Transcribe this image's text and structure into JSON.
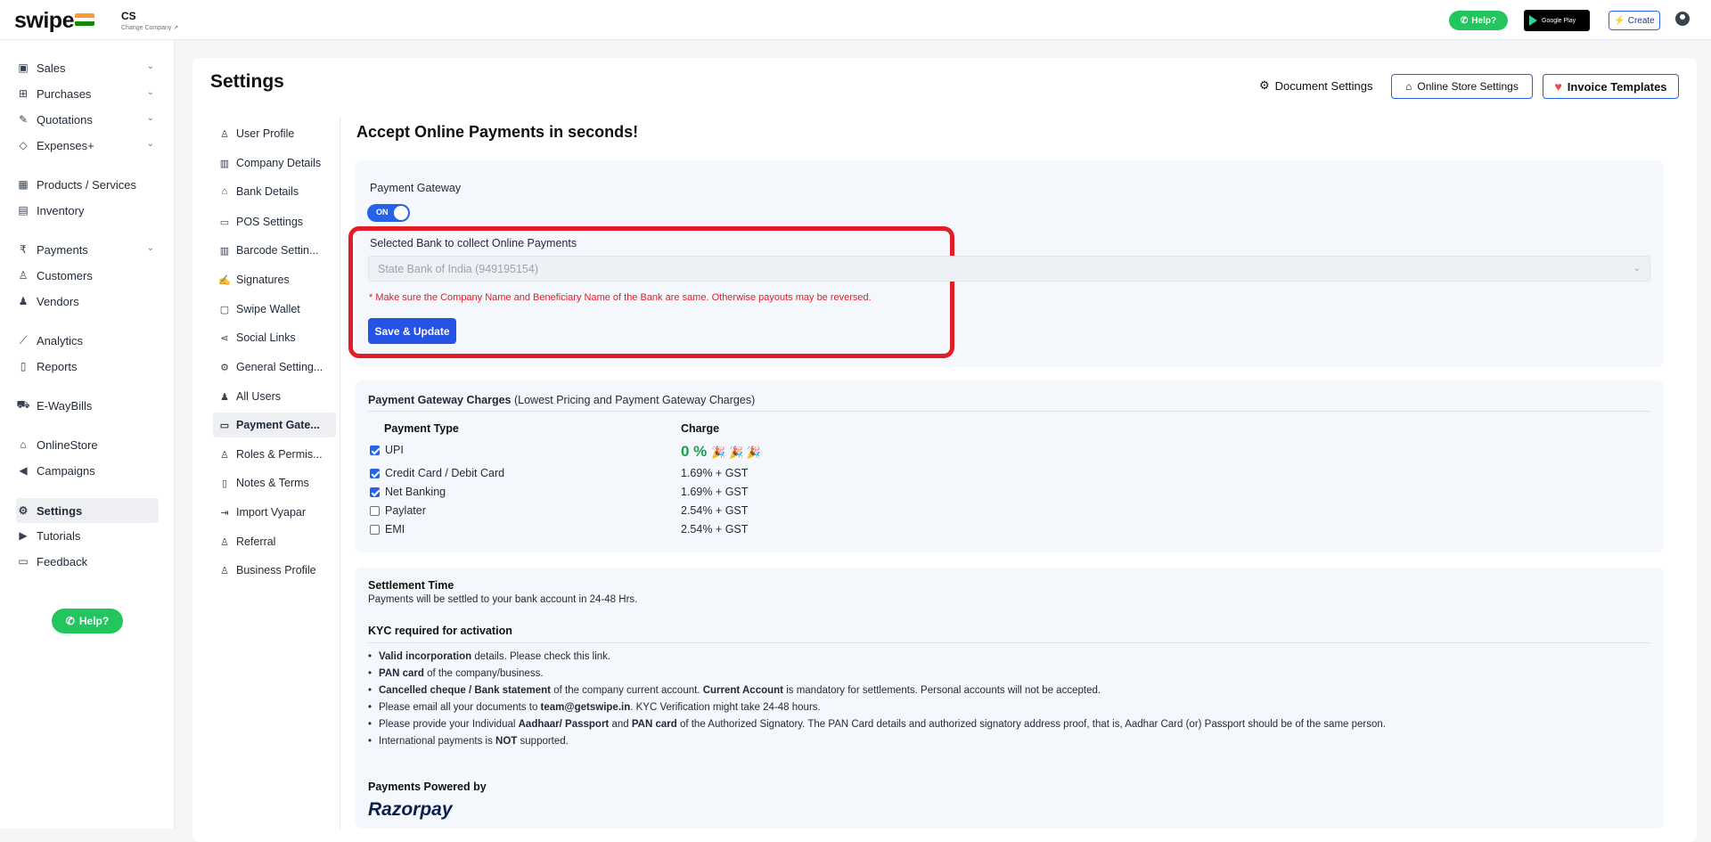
{
  "header": {
    "logo": "swipe",
    "company_name": "CS",
    "change_company": "Change Company ↗",
    "help": "Help?",
    "google_play": "Google Play",
    "create": "Create"
  },
  "sidebar": {
    "items": [
      {
        "label": "Sales"
      },
      {
        "label": "Purchases"
      },
      {
        "label": "Quotations"
      },
      {
        "label": "Expenses+"
      },
      {
        "label": "Products / Services"
      },
      {
        "label": "Inventory"
      },
      {
        "label": "Payments"
      },
      {
        "label": "Customers"
      },
      {
        "label": "Vendors"
      },
      {
        "label": "Analytics"
      },
      {
        "label": "Reports"
      },
      {
        "label": "E-WayBills"
      },
      {
        "label": "OnlineStore"
      },
      {
        "label": "Campaigns"
      },
      {
        "label": "Settings"
      },
      {
        "label": "Tutorials"
      },
      {
        "label": "Feedback"
      }
    ],
    "help": "Help?"
  },
  "settings": {
    "title": "Settings",
    "document_settings": "Document Settings",
    "online_store_settings": "Online Store Settings",
    "invoice_templates": "Invoice Templates",
    "subnav": [
      {
        "label": "User Profile"
      },
      {
        "label": "Company Details"
      },
      {
        "label": "Bank Details"
      },
      {
        "label": "POS Settings"
      },
      {
        "label": "Barcode Settin..."
      },
      {
        "label": "Signatures"
      },
      {
        "label": "Swipe Wallet"
      },
      {
        "label": "Social Links"
      },
      {
        "label": "General Setting..."
      },
      {
        "label": "All Users"
      },
      {
        "label": "Payment Gate..."
      },
      {
        "label": "Roles & Permis..."
      },
      {
        "label": "Notes & Terms"
      },
      {
        "label": "Import Vyapar"
      },
      {
        "label": "Referral"
      },
      {
        "label": "Business Profile"
      }
    ]
  },
  "payments": {
    "heading": "Accept Online Payments in seconds!",
    "gateway_label": "Payment Gateway",
    "toggle": "ON",
    "bank_label": "Selected Bank to collect Online Payments",
    "bank_value": "State Bank of India (949195154)",
    "warning": "* Make sure the Company Name and Beneficiary Name of the Bank are same. Otherwise payouts may be reversed.",
    "save_button": "Save & Update"
  },
  "charges": {
    "title_bold": "Payment Gateway Charges",
    "title_rest": " (Lowest Pricing and Payment Gateway Charges)",
    "col_type": "Payment Type",
    "col_charge": "Charge",
    "rows": [
      {
        "type": "UPI",
        "charge": "0 %",
        "checked": true
      },
      {
        "type": "Credit Card / Debit Card",
        "charge": "1.69% + GST",
        "checked": true
      },
      {
        "type": "Net Banking",
        "charge": "1.69% + GST",
        "checked": true
      },
      {
        "type": "Paylater",
        "charge": "2.54% + GST",
        "checked": false
      },
      {
        "type": "EMI",
        "charge": "2.54% + GST",
        "checked": false
      }
    ]
  },
  "settlement": {
    "title": "Settlement Time",
    "text": "Payments will be settled to your bank account in 24-48 Hrs.",
    "kyc_title": "KYC required for activation",
    "kyc_items": [
      {
        "b": "Valid incorporation",
        "t": " details. Please check this link."
      },
      {
        "b": "PAN card",
        "t": " of the company/business."
      },
      {
        "b": "Cancelled cheque / Bank statement",
        "t": " of the company current account. ",
        "b2": "Current Account",
        "t2": " is mandatory for settlements. Personal accounts will not be accepted."
      },
      {
        "t0": "Please email all your documents to ",
        "b": "team@getswipe.in",
        "t": ". KYC Verification might take 24-48 hours."
      },
      {
        "t0": "Please provide your Individual ",
        "b": "Aadhaar/ Passport",
        "t": " and ",
        "b2": "PAN card",
        "t2": " of the Authorized Signatory. The PAN Card details and authorized signatory address proof, that is, Aadhar Card (or) Passport should be of the same person."
      },
      {
        "t0": "International payments is ",
        "b": "NOT",
        "t": " supported."
      }
    ],
    "powered_by": "Payments Powered by",
    "razorpay": "Razorpay"
  }
}
